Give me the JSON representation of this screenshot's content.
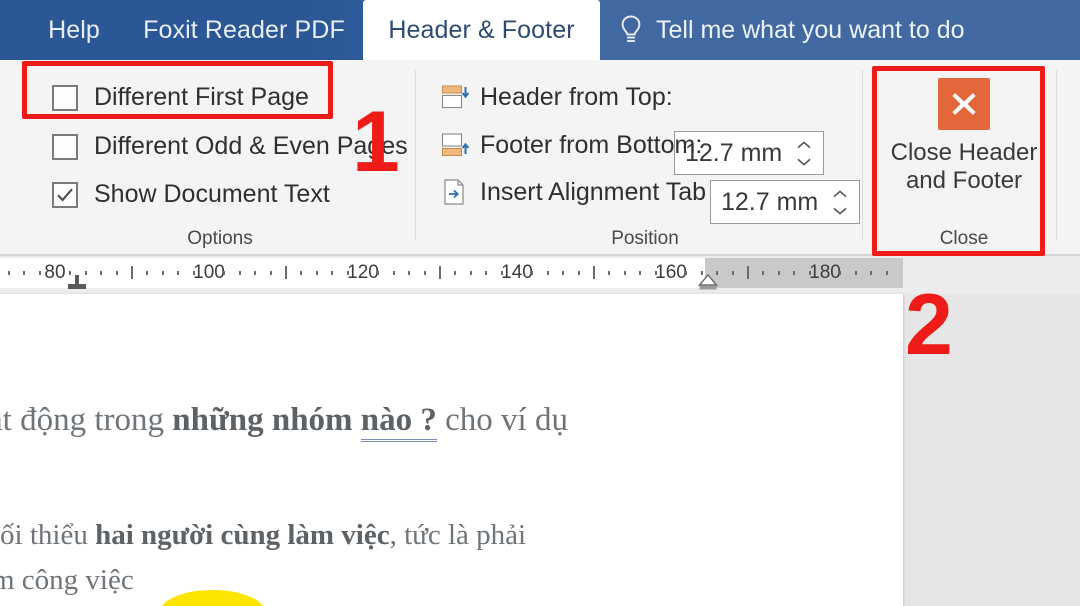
{
  "tabstrip": {
    "tabs": [
      {
        "label": "Help",
        "active": false
      },
      {
        "label": "Foxit Reader PDF",
        "active": false
      },
      {
        "label": "Header & Footer",
        "active": true
      }
    ],
    "tell_me": "Tell me what you want to do",
    "tell_me_icon": "lightbulb-icon",
    "background_color": "#2B5797"
  },
  "ribbon": {
    "options_group": {
      "label": "Options",
      "items": [
        {
          "label": "Different First Page",
          "checked": false
        },
        {
          "label": "Different Odd & Even Pages",
          "checked": false
        },
        {
          "label": "Show Document Text",
          "checked": true
        }
      ]
    },
    "position_group": {
      "label": "Position",
      "header_from_top": {
        "label": "Header from Top:",
        "value": "12.7 mm",
        "icon": "header-position-icon"
      },
      "footer_from_bottom": {
        "label": "Footer from Bottom:",
        "value": "12.7 mm",
        "icon": "footer-position-icon"
      },
      "insert_alignment_tab": {
        "label": "Insert Alignment Tab",
        "icon": "alignment-tab-icon"
      }
    },
    "close_group": {
      "label": "Close",
      "button_line1": "Close Header",
      "button_line2": "and Footer",
      "icon": "close-x-icon",
      "icon_color": "#E2673B"
    }
  },
  "ruler": {
    "numbers": [
      80,
      100,
      120,
      140,
      160,
      180
    ],
    "unit": "mm",
    "left_tab_marker": "left-tab-stop",
    "indent_marker": "left-indent-marker"
  },
  "document": {
    "line1_plain_a": "ạt động trong ",
    "line1_bold_a": "những nhóm ",
    "line1_bold_underline": "nào ?",
    "line1_plain_b": " cho ví dụ",
    "line2_plain_a": "tối thiểu ",
    "line2_bold": "hai người cùng làm việc",
    "line2_plain_b": ", tức là phải",
    "line3": "m công việc"
  },
  "annotations": {
    "step1": "1",
    "step2": "2",
    "color": "#EE1C19"
  }
}
